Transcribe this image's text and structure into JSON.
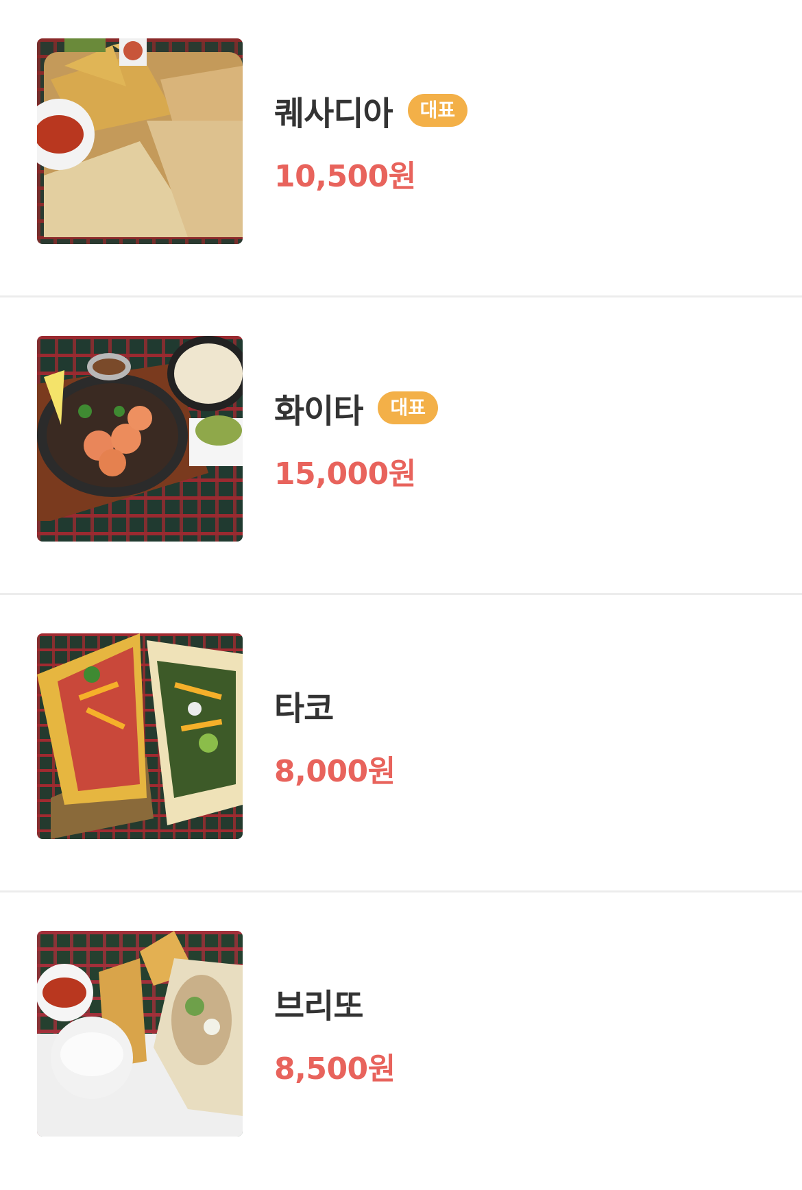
{
  "menu": {
    "items": [
      {
        "name": "퀘사디아",
        "badge": "대표",
        "price": "10,500원",
        "image_icon": "quesadilla-photo"
      },
      {
        "name": "화이타",
        "badge": "대표",
        "price": "15,000원",
        "image_icon": "fajita-photo"
      },
      {
        "name": "타코",
        "price": "8,000원",
        "image_icon": "taco-photo"
      },
      {
        "name": "브리또",
        "price": "8,500원",
        "image_icon": "burrito-photo"
      }
    ]
  },
  "colors": {
    "badge_bg": "#f3b048",
    "price": "#e8635c",
    "name": "#333333",
    "divider": "#ececec"
  }
}
